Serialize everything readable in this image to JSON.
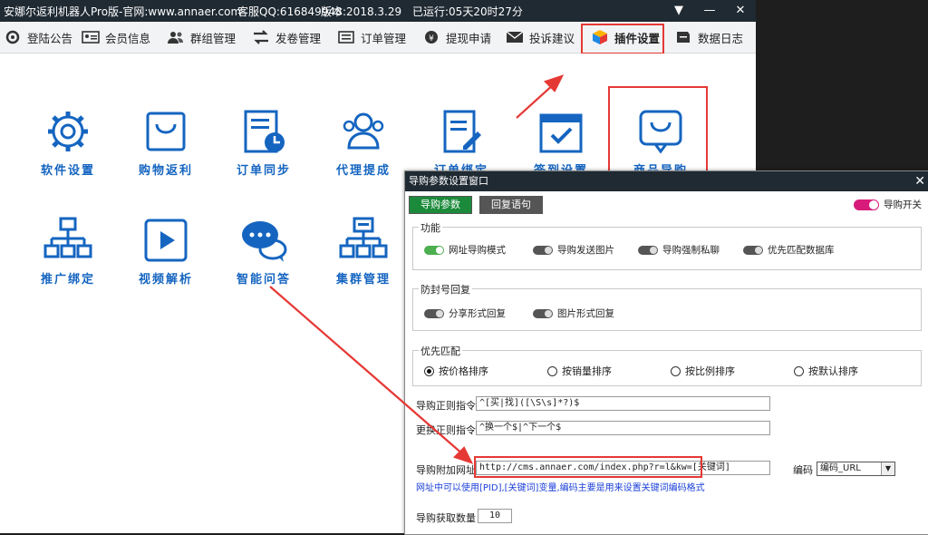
{
  "window": {
    "app_title": "安娜尔返利机器人Pro版-官网:www.annaer.com",
    "service_qq": "客服QQ:616849948",
    "version": "版本:2018.3.29",
    "uptime": "已运行:05天20时27分",
    "btn_menu": "▼",
    "btn_min": "—",
    "btn_close": "✕"
  },
  "toolbar": [
    {
      "label": "登陆公告",
      "icon": "gear-cog-icon"
    },
    {
      "label": "会员信息",
      "icon": "id-card-icon"
    },
    {
      "label": "群组管理",
      "icon": "users-icon"
    },
    {
      "label": "发卷管理",
      "icon": "exchange-arrows-icon"
    },
    {
      "label": "订单管理",
      "icon": "cart-icon"
    },
    {
      "label": "提现申请",
      "icon": "coin-icon"
    },
    {
      "label": "投诉建议",
      "icon": "envelope-icon"
    },
    {
      "label": "插件设置",
      "icon": "cube-icon"
    },
    {
      "label": "数据日志",
      "icon": "database-icon"
    }
  ],
  "tiles": [
    {
      "label": "软件设置",
      "icon": "settings-gear-icon"
    },
    {
      "label": "购物返利",
      "icon": "shopping-bag-icon"
    },
    {
      "label": "订单同步",
      "icon": "order-clock-icon"
    },
    {
      "label": "代理提成",
      "icon": "agents-icon"
    },
    {
      "label": "订单绑定",
      "icon": "order-edit-icon"
    },
    {
      "label": "签到设置",
      "icon": "calendar-check-icon"
    },
    {
      "label": "商品导购",
      "icon": "chat-smile-icon"
    },
    {
      "label": "推广绑定",
      "icon": "org-chart-icon"
    },
    {
      "label": "视频解析",
      "icon": "play-icon"
    },
    {
      "label": "智能问答",
      "icon": "chat-bubbles-icon"
    },
    {
      "label": "集群管理",
      "icon": "cluster-icon"
    }
  ],
  "dialog": {
    "title": "导购参数设置窗口",
    "close": "✕",
    "tab_params": "导购参数",
    "tab_reply": "回复语句",
    "switch_label": "导购开关",
    "group_function": {
      "title": "功能",
      "toggles": [
        {
          "label": "网址导购模式",
          "on": true
        },
        {
          "label": "导购发送图片",
          "on": false
        },
        {
          "label": "导购强制私聊",
          "on": false
        },
        {
          "label": "优先匹配数据库",
          "on": false
        }
      ]
    },
    "group_anti": {
      "title": "防封号回复",
      "toggles": [
        {
          "label": "分享形式回复",
          "on": false
        },
        {
          "label": "图片形式回复",
          "on": false
        }
      ]
    },
    "group_priority": {
      "title": "优先匹配",
      "radios": [
        {
          "label": "按价格排序",
          "checked": true
        },
        {
          "label": "按销量排序",
          "checked": false
        },
        {
          "label": "按比例排序",
          "checked": false
        },
        {
          "label": "按默认排序",
          "checked": false
        }
      ]
    },
    "regex_label": "导购正则指令",
    "regex_value": "^[买|找]([\\S\\s]*?)$",
    "more_label": "更换正则指令",
    "more_value": "^换一个$|^下一个$",
    "url_label": "导购附加网址",
    "url_value": "http://cms.annaer.com/index.php?r=l&kw=[关键词]",
    "encoding_label": "编码",
    "encoding_value": "编码_URL",
    "hint": "网址中可以使用[PID],[关键词]变量,编码主要是用来设置关键词编码格式",
    "count_label": "导购获取数量",
    "count_value": "10"
  },
  "colors": {
    "titlebar": "#1f2a33",
    "accent_blue": "#1565c0",
    "highlight_red": "#e53935",
    "toggle_on": "#4caf50",
    "tab_active": "#1b8a3a",
    "switch_pink": "#d81b7a",
    "hint_blue": "#1a3fd8"
  }
}
